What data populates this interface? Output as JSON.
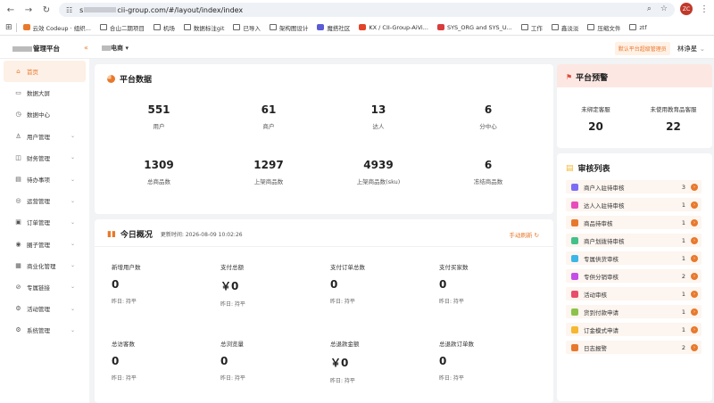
{
  "browser": {
    "url_prefix": "s",
    "url_rest": "cii-group.com/#/layout/index/index",
    "profile_initials": "ZC",
    "bookmarks": [
      {
        "label": "云效 Codeup · 组织...",
        "color": "#e8792c"
      },
      {
        "label": "合山二期项目",
        "color": ""
      },
      {
        "label": "机场",
        "color": ""
      },
      {
        "label": "数据标注git",
        "color": ""
      },
      {
        "label": "已导入",
        "color": ""
      },
      {
        "label": "架构图设计",
        "color": ""
      },
      {
        "label": "魔搭社区",
        "color": "#5b5bd6"
      },
      {
        "label": "KX / CII-Group-AiVi...",
        "color": "#e24329"
      },
      {
        "label": "SYS_ORG and SYS_U...",
        "color": "#d93c3c"
      },
      {
        "label": "工作",
        "color": ""
      },
      {
        "label": "鑫淡淡",
        "color": ""
      },
      {
        "label": "压缩文件",
        "color": ""
      },
      {
        "label": "ztf",
        "color": ""
      }
    ]
  },
  "header": {
    "brand_suffix": "管理平台",
    "shop_suffix": "电商",
    "platform_tag": "默认平台超级管理员",
    "username": "林诤星"
  },
  "sidebar": {
    "items": [
      {
        "label": "首页",
        "icon": "home-icon",
        "glyph": "⌂",
        "expandable": false,
        "active": true
      },
      {
        "label": "数据大屏",
        "icon": "monitor-icon",
        "glyph": "▭",
        "expandable": false,
        "active": false
      },
      {
        "label": "数据中心",
        "icon": "clock-icon",
        "glyph": "◷",
        "expandable": false,
        "active": false
      },
      {
        "label": "用户管理",
        "icon": "user-icon",
        "glyph": "♙",
        "expandable": true,
        "active": false
      },
      {
        "label": "财务管理",
        "icon": "finance-icon",
        "glyph": "◫",
        "expandable": true,
        "active": false
      },
      {
        "label": "待办事项",
        "icon": "todo-icon",
        "glyph": "▤",
        "expandable": true,
        "active": false
      },
      {
        "label": "运营管理",
        "icon": "operation-icon",
        "glyph": "◎",
        "expandable": true,
        "active": false
      },
      {
        "label": "订单管理",
        "icon": "order-icon",
        "glyph": "▣",
        "expandable": true,
        "active": false
      },
      {
        "label": "圈子管理",
        "icon": "circle-icon",
        "glyph": "◉",
        "expandable": true,
        "active": false
      },
      {
        "label": "商业化管理",
        "icon": "business-icon",
        "glyph": "▦",
        "expandable": true,
        "active": false
      },
      {
        "label": "专属链接",
        "icon": "link-icon",
        "glyph": "⊘",
        "expandable": true,
        "active": false
      },
      {
        "label": "活动管理",
        "icon": "activity-icon",
        "glyph": "⚙",
        "expandable": true,
        "active": false
      },
      {
        "label": "系统管理",
        "icon": "settings-icon",
        "glyph": "⚙",
        "expandable": true,
        "active": false
      }
    ]
  },
  "platform": {
    "title": "平台数据",
    "stats": [
      {
        "value": "551",
        "label": "用户"
      },
      {
        "value": "61",
        "label": "商户"
      },
      {
        "value": "13",
        "label": "达人"
      },
      {
        "value": "6",
        "label": "分中心"
      },
      {
        "value": "1309",
        "label": "总商品数"
      },
      {
        "value": "1297",
        "label": "上架商品数"
      },
      {
        "value": "4939",
        "label": "上架商品数(sku)"
      },
      {
        "value": "6",
        "label": "冻结商品数"
      }
    ]
  },
  "today": {
    "title": "今日概况",
    "update_label": "更新时间: 2026-08-09 10:02:26",
    "refresh_label": "手动刷新",
    "stats": [
      {
        "label": "新增用户数",
        "value": "0",
        "compare": "昨日: 持平"
      },
      {
        "label": "支付总额",
        "value": "￥0",
        "compare": "昨日: 持平"
      },
      {
        "label": "支付订单总数",
        "value": "0",
        "compare": "昨日: 持平"
      },
      {
        "label": "支付买家数",
        "value": "0",
        "compare": "昨日: 持平"
      },
      {
        "label": "总访客数",
        "value": "0",
        "compare": "昨日: 持平"
      },
      {
        "label": "总浏览量",
        "value": "0",
        "compare": "昨日: 持平"
      },
      {
        "label": "总退款金额",
        "value": "￥0",
        "compare": "昨日: 持平"
      },
      {
        "label": "总退款订单数",
        "value": "0",
        "compare": "昨日: 持平"
      }
    ]
  },
  "warning": {
    "title": "平台预警",
    "stats": [
      {
        "label": "未绑定客服",
        "value": "20"
      },
      {
        "label": "未使用教育品客服",
        "value": "22"
      }
    ]
  },
  "audit": {
    "title": "审核列表",
    "items": [
      {
        "label": "商户入驻待审核",
        "count": "3",
        "color": "#7b6cf6"
      },
      {
        "label": "达人入驻待审核",
        "count": "1",
        "color": "#e84dbb"
      },
      {
        "label": "商品待审核",
        "count": "1",
        "color": "#e8792c"
      },
      {
        "label": "商户划拨待审核",
        "count": "1",
        "color": "#44c08a"
      },
      {
        "label": "专属供货审核",
        "count": "1",
        "color": "#3cb6e8"
      },
      {
        "label": "专供分销审核",
        "count": "2",
        "color": "#c44de8"
      },
      {
        "label": "活动审核",
        "count": "1",
        "color": "#e84d6b"
      },
      {
        "label": "货到付款申请",
        "count": "1",
        "color": "#8bc34a"
      },
      {
        "label": "订金模式申请",
        "count": "1",
        "color": "#f5b82e"
      },
      {
        "label": "日志报警",
        "count": "2",
        "color": "#e8792c"
      }
    ]
  }
}
